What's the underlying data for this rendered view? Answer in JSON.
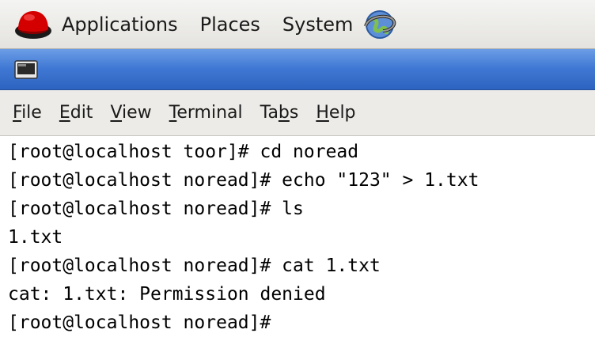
{
  "panel": {
    "menus": {
      "applications": "Applications",
      "places": "Places",
      "system": "System"
    },
    "icons": {
      "distro_logo": "redhat-logo-icon",
      "browser": "web-browser-icon"
    }
  },
  "window": {
    "title_icon": "terminal-window-icon",
    "menu": {
      "file": {
        "before": "",
        "key": "F",
        "after": "ile"
      },
      "edit": {
        "before": "",
        "key": "E",
        "after": "dit"
      },
      "view": {
        "before": "",
        "key": "V",
        "after": "iew"
      },
      "terminal": {
        "before": "",
        "key": "T",
        "after": "erminal"
      },
      "tabs": {
        "before": "Ta",
        "key": "b",
        "after": "s"
      },
      "help": {
        "before": "",
        "key": "H",
        "after": "elp"
      }
    }
  },
  "terminal": {
    "lines": [
      "[root@localhost toor]# cd noread",
      "[root@localhost noread]# echo \"123\" > 1.txt",
      "[root@localhost noread]# ls",
      "1.txt",
      "[root@localhost noread]# cat 1.txt",
      "cat: 1.txt: Permission denied",
      "[root@localhost noread]# "
    ]
  },
  "colors": {
    "title_bar": "#3f78d4",
    "panel": "#e9e8e4",
    "menu_bar": "#ecebe7",
    "terminal_bg": "#ffffff",
    "terminal_fg": "#000000",
    "logo_red": "#cc0000"
  }
}
